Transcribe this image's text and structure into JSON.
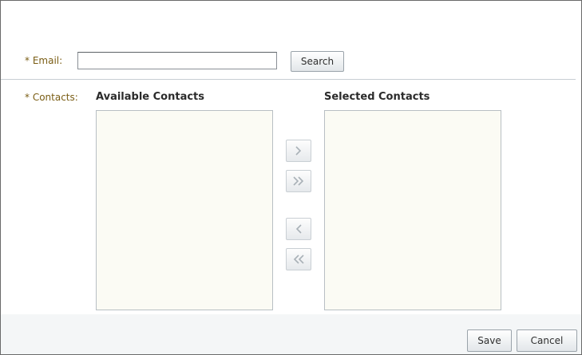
{
  "form": {
    "email": {
      "required_marker": "*",
      "label": "Email:",
      "value": "",
      "placeholder": ""
    },
    "search_label": "Search",
    "contacts": {
      "required_marker": "*",
      "label": "Contacts:"
    }
  },
  "shuttle": {
    "available_title": "Available Contacts",
    "selected_title": "Selected Contacts",
    "available_items": [],
    "selected_items": [],
    "controls": {
      "move_icon": "chevron-right-icon",
      "move_all_icon": "double-chevron-right-icon",
      "remove_icon": "chevron-left-icon",
      "remove_all_icon": "double-chevron-left-icon"
    }
  },
  "footer": {
    "save_label": "Save",
    "cancel_label": "Cancel"
  },
  "colors": {
    "label": "#7a5d14",
    "list_background": "#fbfbf4",
    "footer_band": "#f4f6f7",
    "icon_stroke": "#a9b1b7"
  }
}
